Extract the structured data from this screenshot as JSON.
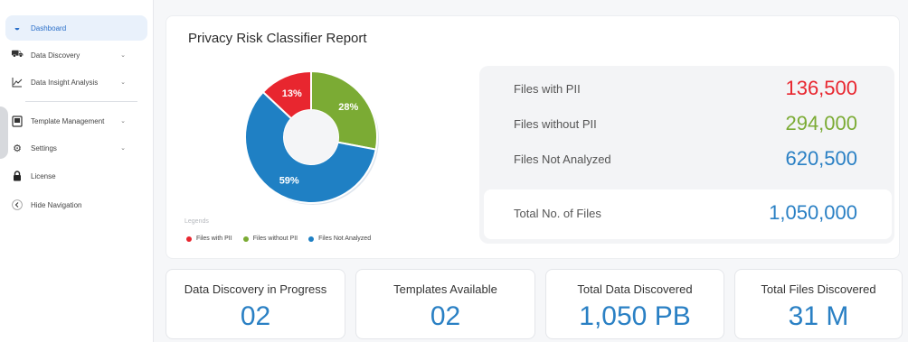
{
  "sidebar": {
    "items": [
      {
        "label": "Dashboard",
        "icon": "gauge-icon",
        "chevron": ""
      },
      {
        "label": "Data Discovery",
        "icon": "truck-icon",
        "chevron": "⌄"
      },
      {
        "label": "Data Insight Analysis",
        "icon": "line-chart-icon",
        "chevron": "⌄"
      },
      {
        "label": "Template Management",
        "icon": "template-icon",
        "chevron": "⌄"
      },
      {
        "label": "Settings",
        "icon": "gear-icon",
        "chevron": "⌄"
      },
      {
        "label": "License",
        "icon": "lock-icon",
        "chevron": ""
      },
      {
        "label": "Hide Navigation",
        "icon": "chevron-left-icon",
        "chevron": ""
      }
    ]
  },
  "report": {
    "title": "Privacy Risk Classifier Report",
    "legend_title": "Legends",
    "legend": [
      {
        "label": "Files with PII",
        "color": "#e8262f"
      },
      {
        "label": "Files without PII",
        "color": "#7bab34"
      },
      {
        "label": "Files Not Analyzed",
        "color": "#1f80c4"
      }
    ]
  },
  "chart_data": {
    "type": "pie",
    "donut": true,
    "categories": [
      "Files with PII",
      "Files without PII",
      "Files Not Analyzed"
    ],
    "values": [
      13,
      28,
      59
    ],
    "labels": [
      "13%",
      "28%",
      "59%"
    ],
    "colors": [
      "#e8262f",
      "#7bab34",
      "#1f80c4"
    ],
    "legend_position": "bottom-left"
  },
  "stats": {
    "rows": [
      {
        "label": "Files with PII",
        "value": "136,500",
        "color": "#e8262f"
      },
      {
        "label": "Files without PII",
        "value": "294,000",
        "color": "#7bab34"
      },
      {
        "label": "Files Not Analyzed",
        "value": "620,500",
        "color": "#2a80c4"
      }
    ],
    "total_label": "Total No. of Files",
    "total_value": "1,050,000",
    "total_color": "#2a80c4"
  },
  "cards": [
    {
      "label": "Data Discovery in Progress",
      "value": "02"
    },
    {
      "label": "Templates Available",
      "value": "02"
    },
    {
      "label": "Total Data Discovered",
      "value": "1,050 PB"
    },
    {
      "label": "Total Files Discovered",
      "value": "31 M"
    }
  ]
}
